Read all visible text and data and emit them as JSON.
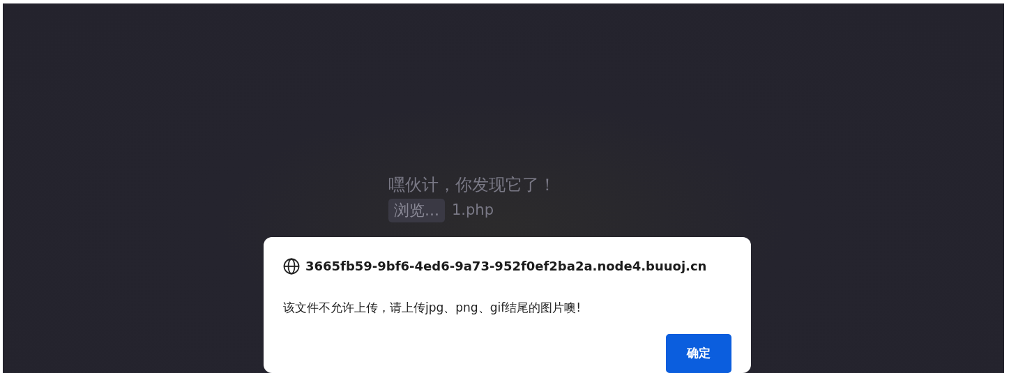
{
  "page": {
    "heading": "嘿伙计，你发现它了！",
    "browse_button": "浏览...",
    "file_name": "1.php"
  },
  "dialog": {
    "title": "3665fb59-9bf6-4ed6-9a73-952f0ef2ba2a.node4.buuoj.cn",
    "message": "该文件不允许上传，请上传jpg、png、gif结尾的图片噢!",
    "ok_button": "确定"
  }
}
